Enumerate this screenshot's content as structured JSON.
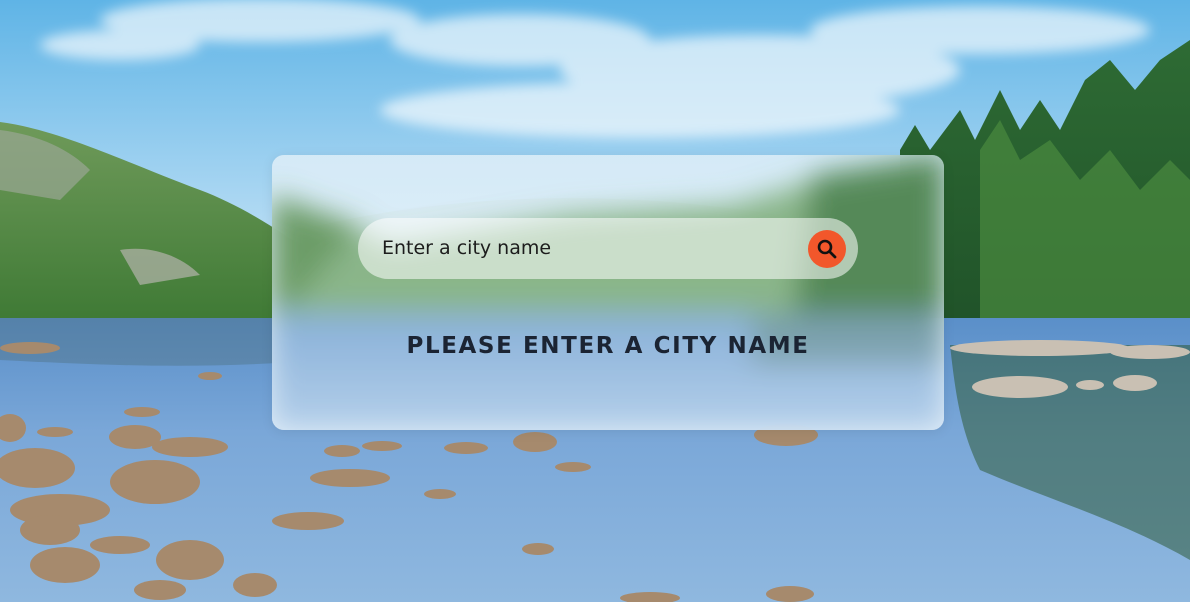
{
  "search": {
    "placeholder": "Enter a city name"
  },
  "message": "PLEASE ENTER A CITY NAME",
  "icons": {
    "search_button": "magnifier-icon"
  },
  "colors": {
    "accent": "#f2572b",
    "message_text": "#1b2433"
  }
}
